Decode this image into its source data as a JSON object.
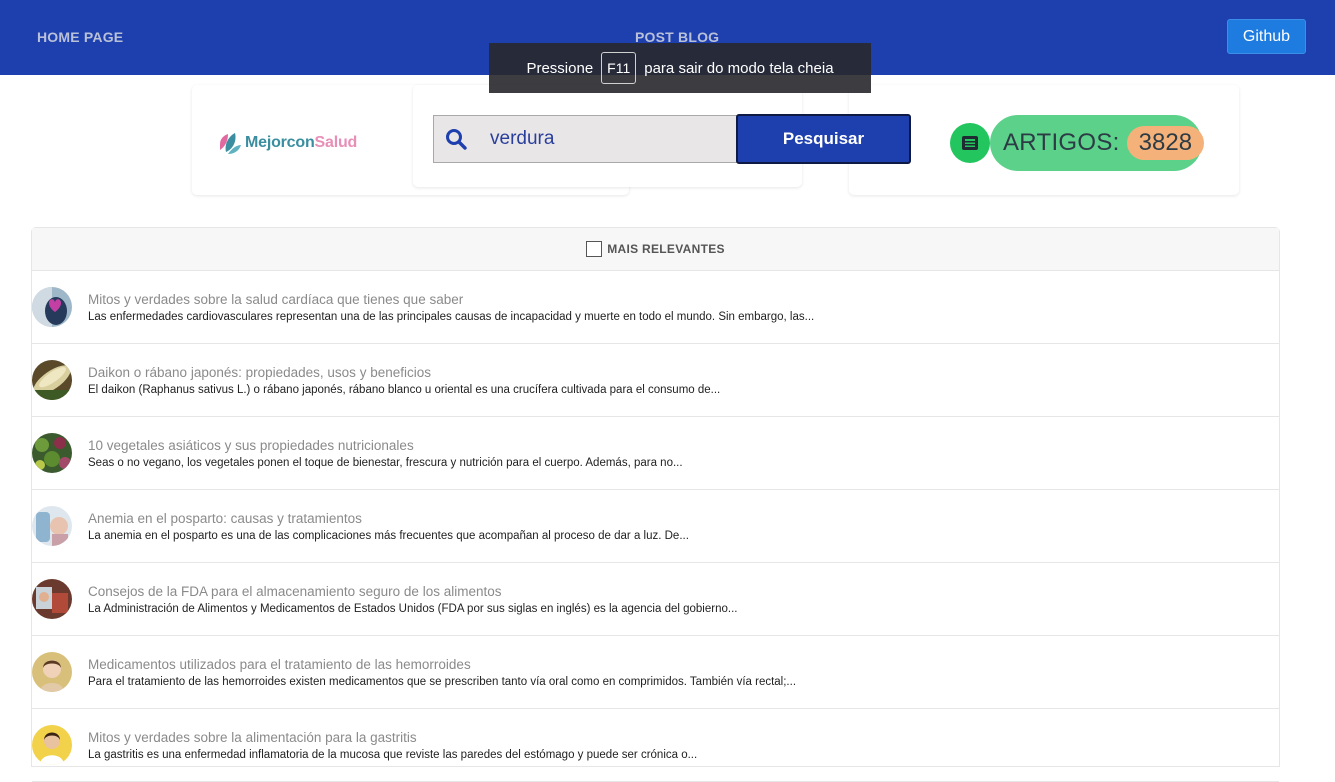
{
  "nav": {
    "home": "HOME PAGE",
    "post": "POST BLOG",
    "github": "Github"
  },
  "fullscreen_toast": {
    "before": "Pressione",
    "key": "F11",
    "after": "para sair do modo tela cheia"
  },
  "logo": {
    "part1": "Mejorcon",
    "part2": "Salud"
  },
  "search": {
    "value": "verdura",
    "button": "Pesquisar"
  },
  "articles": {
    "label": "ARTIGOS:",
    "count": "3828"
  },
  "filter": {
    "label": "MAIS RELEVANTES"
  },
  "colors": {
    "navbar": "#1e3fae",
    "accent_green": "#5bd18a",
    "count_badge": "#f4b27a"
  },
  "items": [
    {
      "title": "Mitos y verdades sobre la salud cardíaca que tienes que saber",
      "desc": "Las enfermedades cardiovasculares representan una de las principales causas de incapacidad y muerte en todo el mundo. Sin embargo, las..."
    },
    {
      "title": "Daikon o rábano japonés: propiedades, usos y beneficios",
      "desc": "El daikon (Raphanus sativus L.) o rábano japonés, rábano blanco u oriental es una crucífera cultivada para el consumo de..."
    },
    {
      "title": "10 vegetales asiáticos y sus propiedades nutricionales",
      "desc": "Seas o no vegano, los vegetales ponen el toque de bienestar, frescura y nutrición para el cuerpo. Además, para no..."
    },
    {
      "title": "Anemia en el posparto: causas y tratamientos",
      "desc": "La anemia en el posparto es una de las complicaciones más frecuentes que acompañan al proceso de dar a luz. De..."
    },
    {
      "title": "Consejos de la FDA para el almacenamiento seguro de los alimentos",
      "desc": "La Administración de Alimentos y Medicamentos de Estados Unidos (FDA por sus siglas en inglés) es la agencia del gobierno..."
    },
    {
      "title": "Medicamentos utilizados para el tratamiento de las hemorroides",
      "desc": "Para el tratamiento de las hemorroides existen medicamentos que se prescriben tanto vía oral como en comprimidos. También vía rectal;..."
    },
    {
      "title": "Mitos y verdades sobre la alimentación para la gastritis",
      "desc": "La gastritis es una enfermedad inflamatoria de la mucosa que reviste las paredes del estómago y puede ser crónica o..."
    }
  ]
}
